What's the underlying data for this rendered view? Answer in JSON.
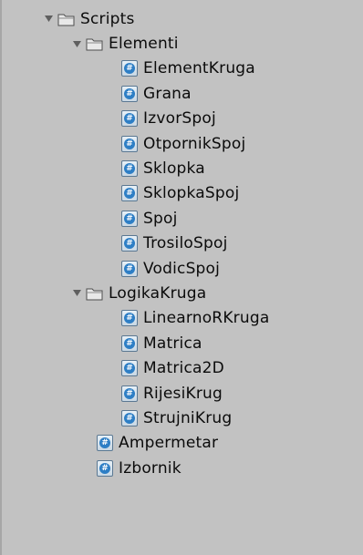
{
  "tree": {
    "root": {
      "label": "Scripts",
      "icon": "folder-icon",
      "expanded": true
    },
    "elementi": {
      "label": "Elementi",
      "icon": "folder-icon",
      "expanded": true,
      "items": [
        "ElementKruga",
        "Grana",
        "IzvorSpoj",
        "OtpornikSpoj",
        "Sklopka",
        "SklopkaSpoj",
        "Spoj",
        "TrosiloSpoj",
        "VodicSpoj"
      ]
    },
    "logikakruga": {
      "label": "LogikaKruga",
      "icon": "folder-icon",
      "expanded": true,
      "items": [
        "LinearnoRKruga",
        "Matrica",
        "Matrica2D",
        "RijesiKrug",
        "StrujniKrug"
      ]
    },
    "loose_items": [
      "Ampermetar",
      "Izbornik"
    ],
    "script_icon_glyph": "#"
  },
  "colors": {
    "background": "#c2c2c2",
    "text": "#0b0b0b",
    "arrow": "#5f5f5f",
    "script_icon_accent": "#2d7ec5"
  }
}
